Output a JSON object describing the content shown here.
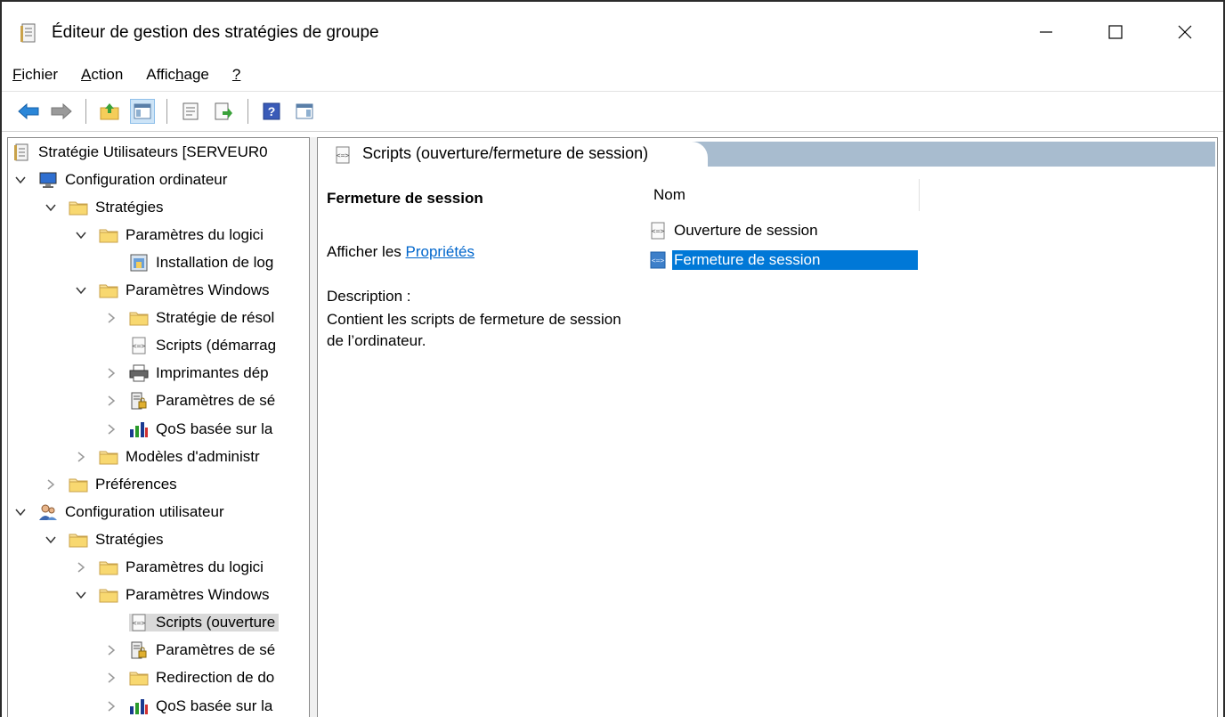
{
  "window": {
    "title": "Éditeur de gestion des stratégies de groupe",
    "controls": {
      "minimize": "—",
      "maximize": "☐",
      "close": "✕"
    }
  },
  "menu": [
    {
      "pre": "",
      "u": "F",
      "post": "ichier"
    },
    {
      "pre": "",
      "u": "A",
      "post": "ction"
    },
    {
      "pre": "Affic",
      "u": "h",
      "post": "age"
    },
    {
      "pre": "",
      "u": "?",
      "post": ""
    }
  ],
  "toolbar": {
    "buttons": [
      "back-arrow-icon",
      "forward-arrow-icon",
      "up-folder-icon",
      "show-hide-tree-icon",
      "properties-icon",
      "export-list-icon",
      "help-icon",
      "action-pane-icon"
    ]
  },
  "tree": [
    {
      "label": "Stratégie Utilisateurs [SERVEUR0",
      "icon": "policy-doc-icon",
      "chevron": "none",
      "level": 0
    },
    {
      "label": "Configuration ordinateur",
      "icon": "computer-icon",
      "chevron": "down",
      "level": 0
    },
    {
      "label": "Stratégies",
      "icon": "folder-icon",
      "chevron": "down",
      "level": 1
    },
    {
      "label": "Paramètres du logici",
      "icon": "folder-icon",
      "chevron": "down",
      "level": 2
    },
    {
      "label": "Installation de log",
      "icon": "install-icon",
      "chevron": "none",
      "level": 3
    },
    {
      "label": "Paramètres Windows",
      "icon": "folder-icon",
      "chevron": "down",
      "level": 2
    },
    {
      "label": "Stratégie de résol",
      "icon": "folder-icon",
      "chevron": "right",
      "level": 3
    },
    {
      "label": "Scripts (démarrag",
      "icon": "script-icon",
      "chevron": "none",
      "level": 3
    },
    {
      "label": "Imprimantes dép",
      "icon": "printer-icon",
      "chevron": "right",
      "level": 3
    },
    {
      "label": "Paramètres de sé",
      "icon": "security-icon",
      "chevron": "right",
      "level": 3
    },
    {
      "label": "QoS basée sur la",
      "icon": "qos-chart-icon",
      "chevron": "right",
      "level": 3
    },
    {
      "label": "Modèles d'administr",
      "icon": "folder-icon",
      "chevron": "right",
      "level": 2
    },
    {
      "label": "Préférences",
      "icon": "folder-icon",
      "chevron": "right",
      "level": 1
    },
    {
      "label": "Configuration utilisateur",
      "icon": "users-icon",
      "chevron": "down",
      "level": 0
    },
    {
      "label": "Stratégies",
      "icon": "folder-icon",
      "chevron": "down",
      "level": 1
    },
    {
      "label": "Paramètres du logici",
      "icon": "folder-icon",
      "chevron": "right",
      "level": 2
    },
    {
      "label": "Paramètres Windows",
      "icon": "folder-icon",
      "chevron": "down",
      "level": 2
    },
    {
      "label": "Scripts (ouverture",
      "icon": "script-icon",
      "chevron": "none",
      "level": 3,
      "selected": true
    },
    {
      "label": "Paramètres de sé",
      "icon": "security-icon",
      "chevron": "right",
      "level": 3
    },
    {
      "label": "Redirection de do",
      "icon": "folder-icon",
      "chevron": "right",
      "level": 3
    },
    {
      "label": "QoS basée sur la",
      "icon": "qos-chart-icon",
      "chevron": "right",
      "level": 3
    }
  ],
  "details": {
    "header": "Scripts (ouverture/fermeture de session)",
    "title": "Fermeture de session",
    "props_prefix": "Afficher les ",
    "props_link": "Propriétés",
    "desc_label": "Description :",
    "description": "Contient les scripts de fermeture de session de l’ordinateur.",
    "column_name": "Nom",
    "items": [
      {
        "label": "Ouverture de session",
        "selected": false
      },
      {
        "label": "Fermeture de session",
        "selected": true
      }
    ]
  },
  "colors": {
    "selection": "#0078d7",
    "header_band": "#a8bccf",
    "link": "#0066cc",
    "tree_selection": "#d9d9d9"
  }
}
